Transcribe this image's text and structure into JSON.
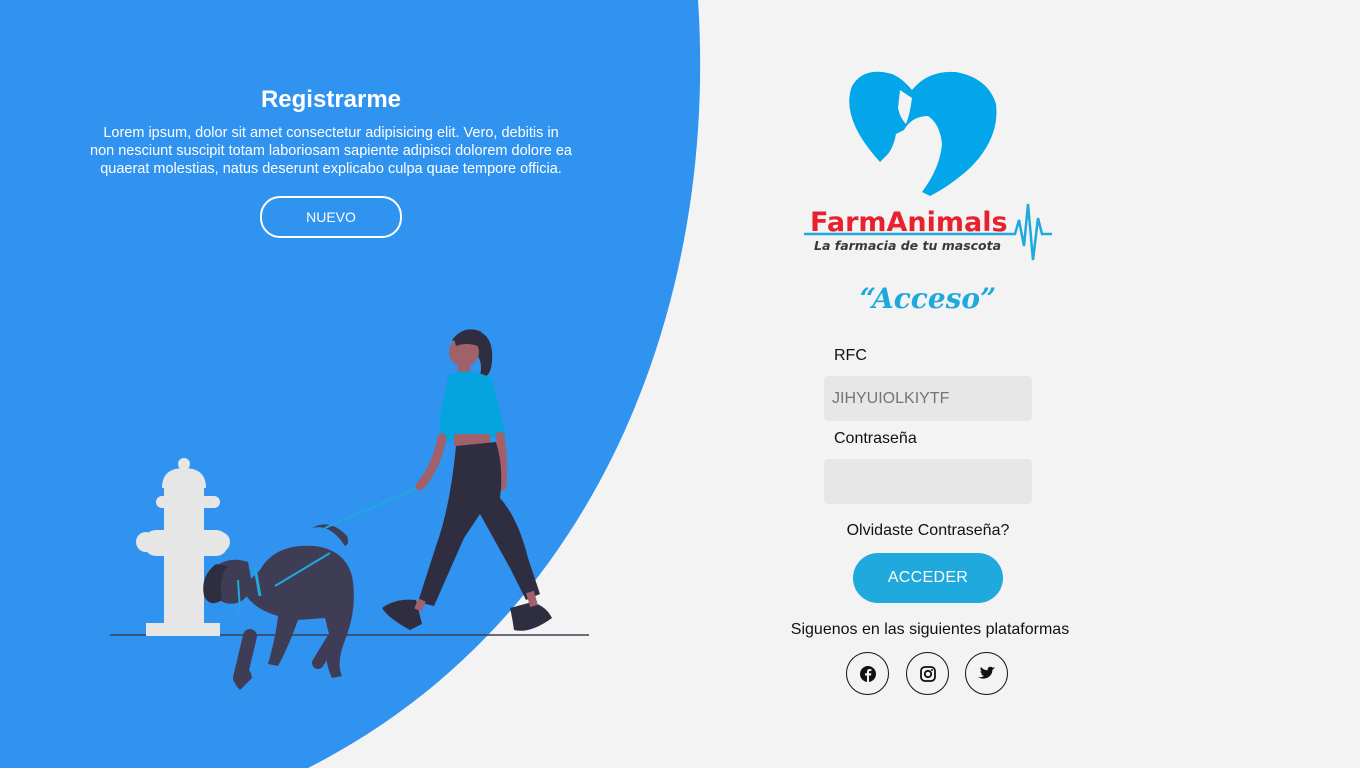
{
  "register": {
    "title": "Registrarme",
    "description": "Lorem ipsum, dolor sit amet consectetur adipisicing elit. Vero, debitis in non nesciunt suscipit totam laboriosam sapiente adipisci dolorem dolore ea quaerat molestias, natus deserunt explicabo culpa quae tempore officia.",
    "button_label": "NUEVO"
  },
  "brand": {
    "name": "FarmAnimals",
    "tagline": "La farmacia de tu mascota"
  },
  "login": {
    "title": "“Acceso”",
    "rfc_label": "RFC",
    "rfc_placeholder": "JIHYUIOLKIYTF",
    "rfc_value": "",
    "password_label": "Contraseña",
    "password_value": "",
    "forgot_label": "Olvidaste Contraseña?",
    "submit_label": "ACCEDER"
  },
  "social": {
    "title": "Siguenos en las siguientes plataformas",
    "icons": [
      "facebook-icon",
      "instagram-icon",
      "twitter-icon"
    ]
  },
  "colors": {
    "primary_blue": "#3193f0",
    "accent": "#1fa9dc",
    "brand_red": "#e8212e",
    "background": "#f3f3f3"
  }
}
